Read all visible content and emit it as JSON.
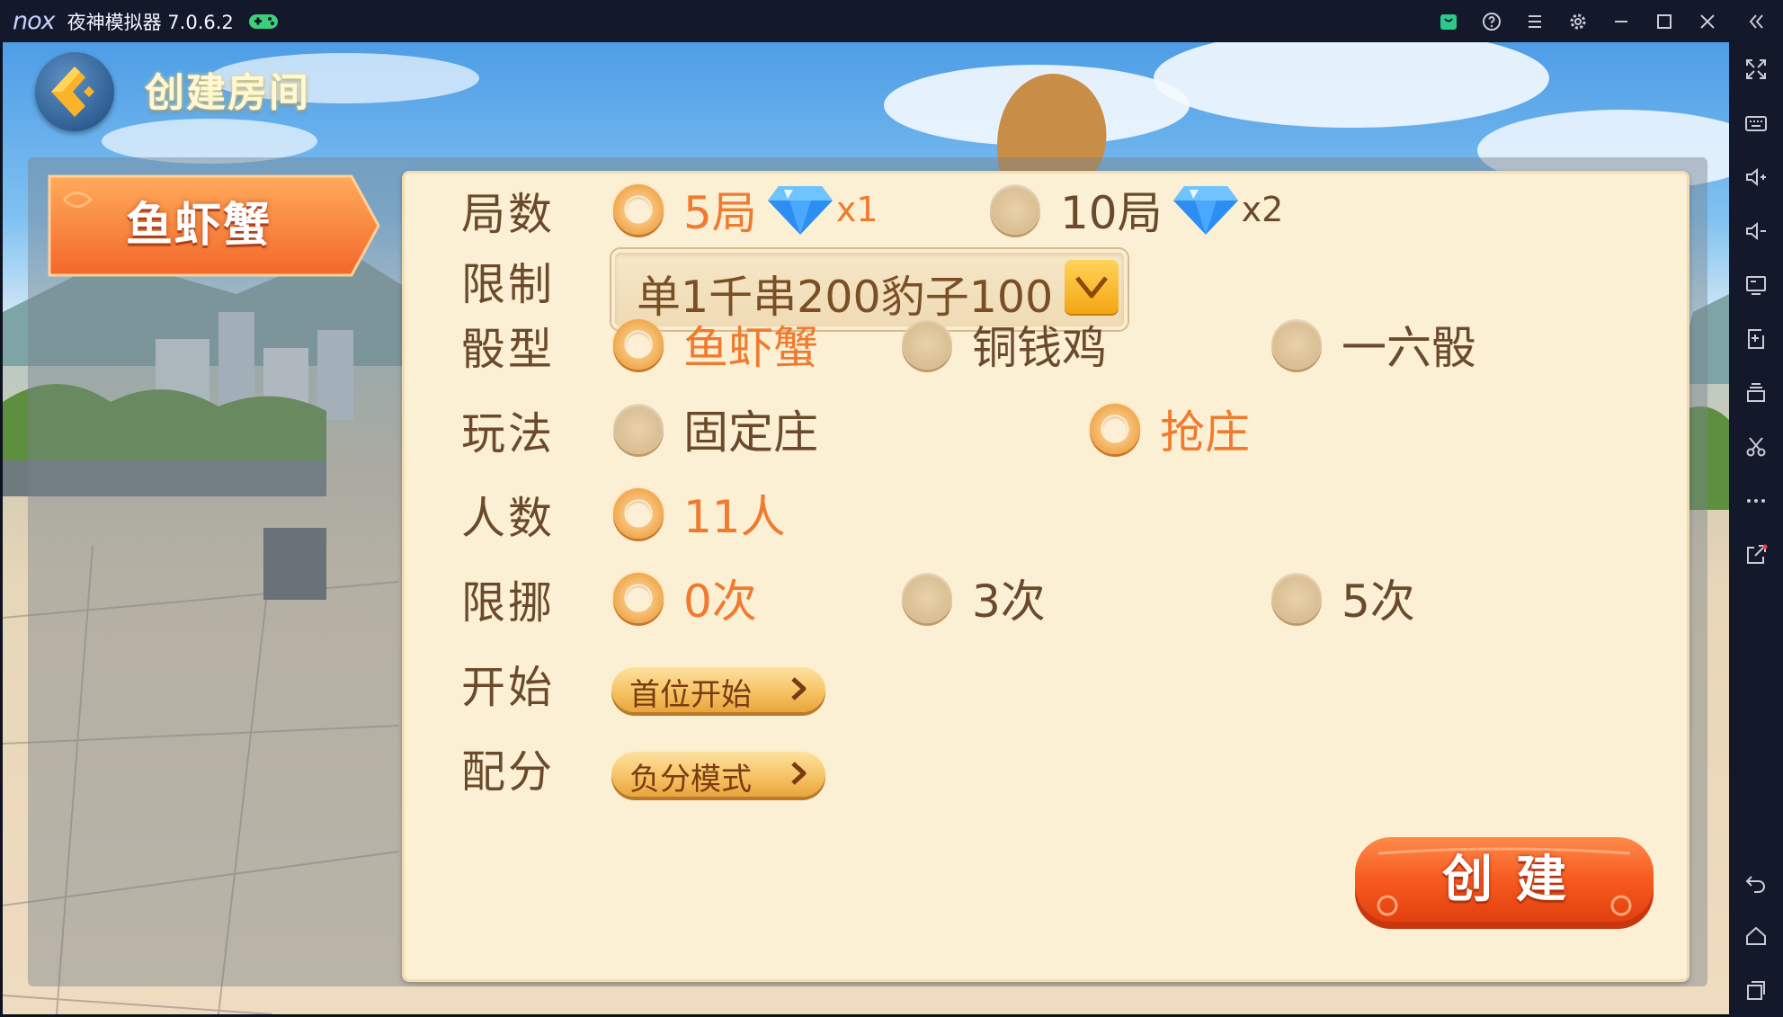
{
  "titlebar": {
    "logo": "nox",
    "title": "夜神模拟器 7.0.6.2",
    "icons": [
      "gamepad-icon",
      "shop-bag-icon",
      "help-icon",
      "menu-icon",
      "settings-icon",
      "minimize-icon",
      "maximize-icon",
      "close-icon",
      "collapse-sidebar-icon"
    ]
  },
  "sidebar": {
    "icons": [
      "fullscreen-icon",
      "keyboard-icon",
      "volume-up-icon",
      "volume-down-icon",
      "screen-icon",
      "apk-install-icon",
      "multi-instance-icon",
      "scissors-icon",
      "more-icon",
      "share-icon",
      "back-icon",
      "home-icon",
      "recent-apps-icon"
    ]
  },
  "game": {
    "back_button": "back-arrow-icon",
    "title": "创建房间",
    "game_tab": "鱼虾蟹",
    "rows": {
      "rounds": {
        "label": "局数",
        "options": [
          {
            "label": "5局",
            "multiplier": "x1",
            "selected": true
          },
          {
            "label": "10局",
            "multiplier": "x2",
            "selected": false
          }
        ]
      },
      "limit": {
        "label": "限制",
        "value": "单1千串200豹子100"
      },
      "dice_type": {
        "label": "骰型",
        "options": [
          {
            "label": "鱼虾蟹",
            "selected": true
          },
          {
            "label": "铜钱鸡",
            "selected": false
          },
          {
            "label": "一六骰",
            "selected": false
          }
        ]
      },
      "play_mode": {
        "label": "玩法",
        "options": [
          {
            "label": "固定庄",
            "selected": false
          },
          {
            "label": "抢庄",
            "selected": true
          }
        ]
      },
      "players": {
        "label": "人数",
        "options": [
          {
            "label": "11人",
            "selected": true
          }
        ]
      },
      "move_limit": {
        "label": "限挪",
        "options": [
          {
            "label": "0次",
            "selected": true
          },
          {
            "label": "3次",
            "selected": false
          },
          {
            "label": "5次",
            "selected": false
          }
        ]
      },
      "start": {
        "label": "开始",
        "button": "首位开始"
      },
      "scoring": {
        "label": "配分",
        "button": "负分模式"
      }
    },
    "create_button": "创建"
  },
  "colors": {
    "panel": "#fbefd4",
    "selected_text": "#f07a2e",
    "label_text": "#6b4a2c",
    "create_button": "#f4511e",
    "titlebar": "#13182b"
  }
}
